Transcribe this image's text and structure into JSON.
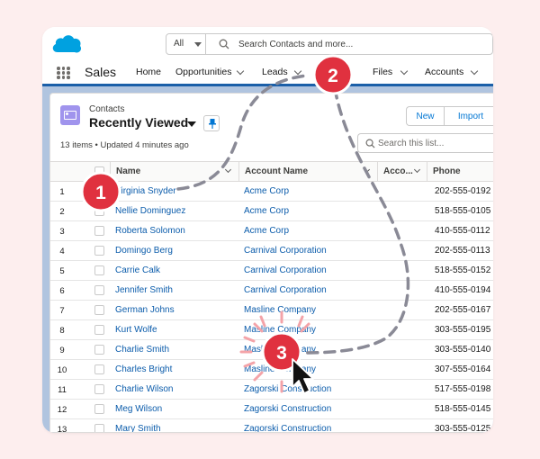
{
  "search": {
    "scope": "All",
    "placeholder": "Search Contacts and more..."
  },
  "nav": {
    "app_name": "Sales",
    "items": [
      "Home",
      "Opportunities",
      "Leads",
      "Files",
      "Accounts"
    ]
  },
  "header": {
    "object_label": "Contacts",
    "list_title": "Recently Viewed",
    "meta": "13 items • Updated 4 minutes ago",
    "new_label": "New",
    "import_label": "Import",
    "list_search_placeholder": "Search this list..."
  },
  "table": {
    "columns": [
      "Name",
      "Account Name",
      "Acco...",
      "Phone"
    ],
    "rows": [
      {
        "n": "1",
        "name": "Virginia Snyder",
        "account": "Acme Corp",
        "phone": "202-555-0192"
      },
      {
        "n": "2",
        "name": "Nellie Dominguez",
        "account": "Acme Corp",
        "phone": "518-555-0105"
      },
      {
        "n": "3",
        "name": "Roberta Solomon",
        "account": "Acme Corp",
        "phone": "410-555-0112"
      },
      {
        "n": "4",
        "name": "Domingo Berg",
        "account": "Carnival Corporation",
        "phone": "202-555-0113"
      },
      {
        "n": "5",
        "name": "Carrie Calk",
        "account": "Carnival Corporation",
        "phone": "518-555-0152"
      },
      {
        "n": "6",
        "name": "Jennifer Smith",
        "account": "Carnival Corporation",
        "phone": "410-555-0194"
      },
      {
        "n": "7",
        "name": "German Johns",
        "account": "Masline Company",
        "phone": "202-555-0167"
      },
      {
        "n": "8",
        "name": "Kurt Wolfe",
        "account": "Masline Company",
        "phone": "303-555-0195"
      },
      {
        "n": "9",
        "name": "Charlie Smith",
        "account": "Masline Company",
        "phone": "303-555-0140"
      },
      {
        "n": "10",
        "name": "Charles Bright",
        "account": "Masline Company",
        "phone": "307-555-0164"
      },
      {
        "n": "11",
        "name": "Charlie Wilson",
        "account": "Zagorski Construction",
        "phone": "517-555-0198"
      },
      {
        "n": "12",
        "name": "Meg Wilson",
        "account": "Zagorski Construction",
        "phone": "518-555-0145"
      },
      {
        "n": "13",
        "name": "Mary Smith",
        "account": "Zagorski Construction",
        "phone": "303-555-0125"
      }
    ]
  },
  "annotations": {
    "step1": "1",
    "step2": "2",
    "step3": "3"
  },
  "colors": {
    "brand_blue": "#1b5fa8",
    "link": "#0b5cab",
    "marker": "#e0313f",
    "path": "#8a8a96",
    "burst": "#f4a3a8"
  }
}
